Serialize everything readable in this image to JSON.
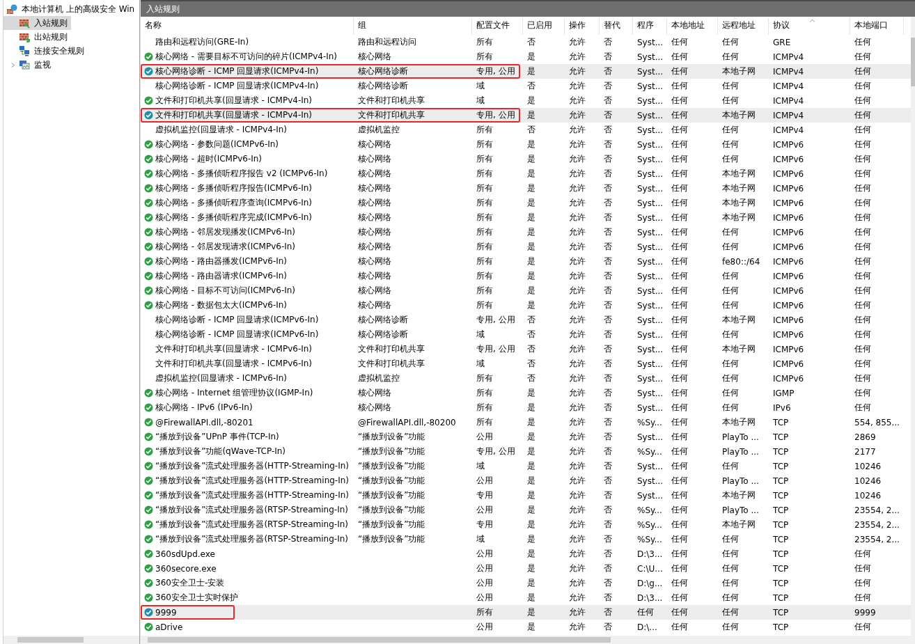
{
  "tree": {
    "root": "本地计算机 上的高级安全 Win",
    "items": [
      {
        "label": "入站规则",
        "kind": "inbound",
        "selected": true,
        "expandable": false
      },
      {
        "label": "出站规则",
        "kind": "outbound",
        "selected": false,
        "expandable": false
      },
      {
        "label": "连接安全规则",
        "kind": "connection",
        "selected": false,
        "expandable": false
      },
      {
        "label": "监视",
        "kind": "monitor",
        "selected": false,
        "expandable": true
      }
    ]
  },
  "pane_title": "入站规则",
  "columns": [
    {
      "label": "名称",
      "sorted": false
    },
    {
      "label": "组",
      "sorted": false
    },
    {
      "label": "配置文件",
      "sorted": false
    },
    {
      "label": "已启用",
      "sorted": false
    },
    {
      "label": "操作",
      "sorted": false
    },
    {
      "label": "替代",
      "sorted": false
    },
    {
      "label": "程序",
      "sorted": false
    },
    {
      "label": "本地地址",
      "sorted": false
    },
    {
      "label": "远程地址",
      "sorted": false
    },
    {
      "label": "协议",
      "sorted": true
    },
    {
      "label": "本地端口",
      "sorted": false
    }
  ],
  "rows": [
    {
      "enabled": false,
      "selected": false,
      "highlighted": false,
      "cells": [
        "路由和远程访问(GRE-In)",
        "路由和远程访问",
        "所有",
        "否",
        "允许",
        "否",
        "Syst...",
        "任何",
        "任何",
        "GRE",
        "任何"
      ]
    },
    {
      "enabled": true,
      "selected": false,
      "highlighted": false,
      "cells": [
        "核心网络 - 需要目标不可访问的碎片(ICMPv4-In)",
        "核心网络",
        "所有",
        "是",
        "允许",
        "否",
        "Syst...",
        "任何",
        "任何",
        "ICMPv4",
        "任何"
      ]
    },
    {
      "enabled": true,
      "selected": true,
      "highlighted": true,
      "cells": [
        "核心网络诊断 - ICMP 回显请求(ICMPv4-In)",
        "核心网络诊断",
        "专用, 公用",
        "是",
        "允许",
        "否",
        "Syst...",
        "任何",
        "本地子网",
        "ICMPv4",
        "任何"
      ]
    },
    {
      "enabled": false,
      "selected": false,
      "highlighted": false,
      "cells": [
        "核心网络诊断 - ICMP 回显请求(ICMPv4-In)",
        "核心网络诊断",
        "域",
        "否",
        "允许",
        "否",
        "Syst...",
        "任何",
        "任何",
        "ICMPv4",
        "任何"
      ]
    },
    {
      "enabled": true,
      "selected": false,
      "highlighted": false,
      "cells": [
        "文件和打印机共享(回显请求 - ICMPv4-In)",
        "文件和打印机共享",
        "域",
        "是",
        "允许",
        "否",
        "Syst...",
        "任何",
        "任何",
        "ICMPv4",
        "任何"
      ]
    },
    {
      "enabled": true,
      "selected": true,
      "highlighted": true,
      "cells": [
        "文件和打印机共享(回显请求 - ICMPv4-In)",
        "文件和打印机共享",
        "专用, 公用",
        "是",
        "允许",
        "否",
        "Syst...",
        "任何",
        "本地子网",
        "ICMPv4",
        "任何"
      ]
    },
    {
      "enabled": false,
      "selected": false,
      "highlighted": false,
      "cells": [
        "虚拟机监控(回显请求 - ICMPv4-In)",
        "虚拟机监控",
        "所有",
        "否",
        "允许",
        "否",
        "Syst...",
        "任何",
        "任何",
        "ICMPv4",
        "任何"
      ]
    },
    {
      "enabled": true,
      "selected": false,
      "highlighted": false,
      "cells": [
        "核心网络 - 参数问题(ICMPv6-In)",
        "核心网络",
        "所有",
        "是",
        "允许",
        "否",
        "Syst...",
        "任何",
        "任何",
        "ICMPv6",
        "任何"
      ]
    },
    {
      "enabled": true,
      "selected": false,
      "highlighted": false,
      "cells": [
        "核心网络 - 超时(ICMPv6-In)",
        "核心网络",
        "所有",
        "是",
        "允许",
        "否",
        "Syst...",
        "任何",
        "任何",
        "ICMPv6",
        "任何"
      ]
    },
    {
      "enabled": true,
      "selected": false,
      "highlighted": false,
      "cells": [
        "核心网络 - 多播侦听程序报告 v2 (ICMPv6-In)",
        "核心网络",
        "所有",
        "是",
        "允许",
        "否",
        "Syst...",
        "任何",
        "本地子网",
        "ICMPv6",
        "任何"
      ]
    },
    {
      "enabled": true,
      "selected": false,
      "highlighted": false,
      "cells": [
        "核心网络 - 多播侦听程序报告(ICMPv6-In)",
        "核心网络",
        "所有",
        "是",
        "允许",
        "否",
        "Syst...",
        "任何",
        "本地子网",
        "ICMPv6",
        "任何"
      ]
    },
    {
      "enabled": true,
      "selected": false,
      "highlighted": false,
      "cells": [
        "核心网络 - 多播侦听程序查询(ICMPv6-In)",
        "核心网络",
        "所有",
        "是",
        "允许",
        "否",
        "Syst...",
        "任何",
        "本地子网",
        "ICMPv6",
        "任何"
      ]
    },
    {
      "enabled": true,
      "selected": false,
      "highlighted": false,
      "cells": [
        "核心网络 - 多播侦听程序完成(ICMPv6-In)",
        "核心网络",
        "所有",
        "是",
        "允许",
        "否",
        "Syst...",
        "任何",
        "本地子网",
        "ICMPv6",
        "任何"
      ]
    },
    {
      "enabled": true,
      "selected": false,
      "highlighted": false,
      "cells": [
        "核心网络 - 邻居发现播发(ICMPv6-In)",
        "核心网络",
        "所有",
        "是",
        "允许",
        "否",
        "Syst...",
        "任何",
        "任何",
        "ICMPv6",
        "任何"
      ]
    },
    {
      "enabled": true,
      "selected": false,
      "highlighted": false,
      "cells": [
        "核心网络 - 邻居发现请求(ICMPv6-In)",
        "核心网络",
        "所有",
        "是",
        "允许",
        "否",
        "Syst...",
        "任何",
        "任何",
        "ICMPv6",
        "任何"
      ]
    },
    {
      "enabled": true,
      "selected": false,
      "highlighted": false,
      "cells": [
        "核心网络 - 路由器播发(ICMPv6-In)",
        "核心网络",
        "所有",
        "是",
        "允许",
        "否",
        "Syst...",
        "任何",
        "fe80::/64",
        "ICMPv6",
        "任何"
      ]
    },
    {
      "enabled": true,
      "selected": false,
      "highlighted": false,
      "cells": [
        "核心网络 - 路由器请求(ICMPv6-In)",
        "核心网络",
        "所有",
        "是",
        "允许",
        "否",
        "Syst...",
        "任何",
        "任何",
        "ICMPv6",
        "任何"
      ]
    },
    {
      "enabled": true,
      "selected": false,
      "highlighted": false,
      "cells": [
        "核心网络 - 目标不可访问(ICMPv6-In)",
        "核心网络",
        "所有",
        "是",
        "允许",
        "否",
        "Syst...",
        "任何",
        "任何",
        "ICMPv6",
        "任何"
      ]
    },
    {
      "enabled": true,
      "selected": false,
      "highlighted": false,
      "cells": [
        "核心网络 - 数据包太大(ICMPv6-In)",
        "核心网络",
        "所有",
        "是",
        "允许",
        "否",
        "Syst...",
        "任何",
        "任何",
        "ICMPv6",
        "任何"
      ]
    },
    {
      "enabled": false,
      "selected": false,
      "highlighted": false,
      "cells": [
        "核心网络诊断 - ICMP 回显请求(ICMPv6-In)",
        "核心网络诊断",
        "专用, 公用",
        "否",
        "允许",
        "否",
        "Syst...",
        "任何",
        "本地子网",
        "ICMPv6",
        "任何"
      ]
    },
    {
      "enabled": false,
      "selected": false,
      "highlighted": false,
      "cells": [
        "核心网络诊断 - ICMP 回显请求(ICMPv6-In)",
        "核心网络诊断",
        "域",
        "否",
        "允许",
        "否",
        "Syst...",
        "任何",
        "任何",
        "ICMPv6",
        "任何"
      ]
    },
    {
      "enabled": false,
      "selected": false,
      "highlighted": false,
      "cells": [
        "文件和打印机共享(回显请求 - ICMPv6-In)",
        "文件和打印机共享",
        "专用, 公用",
        "否",
        "允许",
        "否",
        "Syst...",
        "任何",
        "本地子网",
        "ICMPv6",
        "任何"
      ]
    },
    {
      "enabled": false,
      "selected": false,
      "highlighted": false,
      "cells": [
        "文件和打印机共享(回显请求 - ICMPv6-In)",
        "文件和打印机共享",
        "域",
        "否",
        "允许",
        "否",
        "Syst...",
        "任何",
        "任何",
        "ICMPv6",
        "任何"
      ]
    },
    {
      "enabled": false,
      "selected": false,
      "highlighted": false,
      "cells": [
        "虚拟机监控(回显请求 - ICMPv6-In)",
        "虚拟机监控",
        "所有",
        "否",
        "允许",
        "否",
        "Syst...",
        "任何",
        "任何",
        "ICMPv6",
        "任何"
      ]
    },
    {
      "enabled": true,
      "selected": false,
      "highlighted": false,
      "cells": [
        "核心网络 - Internet 组管理协议(IGMP-In)",
        "核心网络",
        "所有",
        "是",
        "允许",
        "否",
        "Syst...",
        "任何",
        "任何",
        "IGMP",
        "任何"
      ]
    },
    {
      "enabled": true,
      "selected": false,
      "highlighted": false,
      "cells": [
        "核心网络 - IPv6 (IPv6-In)",
        "核心网络",
        "所有",
        "是",
        "允许",
        "否",
        "Syst...",
        "任何",
        "任何",
        "IPv6",
        "任何"
      ]
    },
    {
      "enabled": true,
      "selected": false,
      "highlighted": false,
      "cells": [
        "@FirewallAPI.dll,-80201",
        "@FirewallAPI.dll,-80200",
        "所有",
        "是",
        "允许",
        "否",
        "%Sy...",
        "任何",
        "本地子网",
        "TCP",
        "554, 855..."
      ]
    },
    {
      "enabled": true,
      "selected": false,
      "highlighted": false,
      "cells": [
        "“播放到设备”UPnP 事件(TCP-In)",
        "“播放到设备”功能",
        "公用",
        "是",
        "允许",
        "否",
        "Syst...",
        "任何",
        "PlayTo ...",
        "TCP",
        "2869"
      ]
    },
    {
      "enabled": true,
      "selected": false,
      "highlighted": false,
      "cells": [
        "“播放到设备”功能(qWave-TCP-In)",
        "“播放到设备”功能",
        "专用, 公用",
        "是",
        "允许",
        "否",
        "%Sy...",
        "任何",
        "PlayTo ...",
        "TCP",
        "2177"
      ]
    },
    {
      "enabled": true,
      "selected": false,
      "highlighted": false,
      "cells": [
        "“播放到设备”流式处理服务器(HTTP-Streaming-In)",
        "“播放到设备”功能",
        "域",
        "是",
        "允许",
        "否",
        "Syst...",
        "任何",
        "任何",
        "TCP",
        "10246"
      ]
    },
    {
      "enabled": true,
      "selected": false,
      "highlighted": false,
      "cells": [
        "“播放到设备”流式处理服务器(HTTP-Streaming-In)",
        "“播放到设备”功能",
        "公用",
        "是",
        "允许",
        "否",
        "Syst...",
        "任何",
        "PlayTo ...",
        "TCP",
        "10246"
      ]
    },
    {
      "enabled": true,
      "selected": false,
      "highlighted": false,
      "cells": [
        "“播放到设备”流式处理服务器(HTTP-Streaming-In)",
        "“播放到设备”功能",
        "专用",
        "是",
        "允许",
        "否",
        "Syst...",
        "任何",
        "本地子网",
        "TCP",
        "10246"
      ]
    },
    {
      "enabled": true,
      "selected": false,
      "highlighted": false,
      "cells": [
        "“播放到设备”流式处理服务器(RTSP-Streaming-In)",
        "“播放到设备”功能",
        "公用",
        "是",
        "允许",
        "否",
        "%Sy...",
        "任何",
        "PlayTo ...",
        "TCP",
        "23554, 2..."
      ]
    },
    {
      "enabled": true,
      "selected": false,
      "highlighted": false,
      "cells": [
        "“播放到设备”流式处理服务器(RTSP-Streaming-In)",
        "“播放到设备”功能",
        "专用",
        "是",
        "允许",
        "否",
        "%Sy...",
        "任何",
        "本地子网",
        "TCP",
        "23554, 2..."
      ]
    },
    {
      "enabled": true,
      "selected": false,
      "highlighted": false,
      "cells": [
        "“播放到设备”流式处理服务器(RTSP-Streaming-In)",
        "“播放到设备”功能",
        "域",
        "是",
        "允许",
        "否",
        "%Sy...",
        "任何",
        "任何",
        "TCP",
        "23554, 2..."
      ]
    },
    {
      "enabled": true,
      "selected": false,
      "highlighted": false,
      "cells": [
        "360sdUpd.exe",
        null,
        "公用",
        "是",
        "允许",
        "否",
        "D:\\3...",
        "任何",
        "任何",
        "TCP",
        "任何"
      ]
    },
    {
      "enabled": true,
      "selected": false,
      "highlighted": false,
      "cells": [
        "360secore.exe",
        null,
        "公用",
        "是",
        "允许",
        "否",
        "C:\\U...",
        "任何",
        "任何",
        "TCP",
        "任何"
      ]
    },
    {
      "enabled": true,
      "selected": false,
      "highlighted": false,
      "cells": [
        "360安全卫士-安装",
        null,
        "公用",
        "是",
        "允许",
        "否",
        "D:\\g...",
        "任何",
        "任何",
        "TCP",
        "任何"
      ]
    },
    {
      "enabled": true,
      "selected": false,
      "highlighted": false,
      "cells": [
        "360安全卫士实时保护",
        null,
        "公用",
        "是",
        "允许",
        "否",
        "D:\\3...",
        "任何",
        "任何",
        "TCP",
        "任何"
      ]
    },
    {
      "enabled": true,
      "selected": true,
      "highlighted": true,
      "cells": [
        "9999",
        null,
        "所有",
        "是",
        "允许",
        "否",
        "任何",
        "任何",
        "任何",
        "TCP",
        "9999"
      ]
    },
    {
      "enabled": true,
      "selected": false,
      "highlighted": false,
      "cells": [
        "aDrive",
        null,
        "公用",
        "是",
        "允许",
        "否",
        "D:\\...",
        "任何",
        "任何",
        "TCP",
        "任何"
      ]
    }
  ]
}
